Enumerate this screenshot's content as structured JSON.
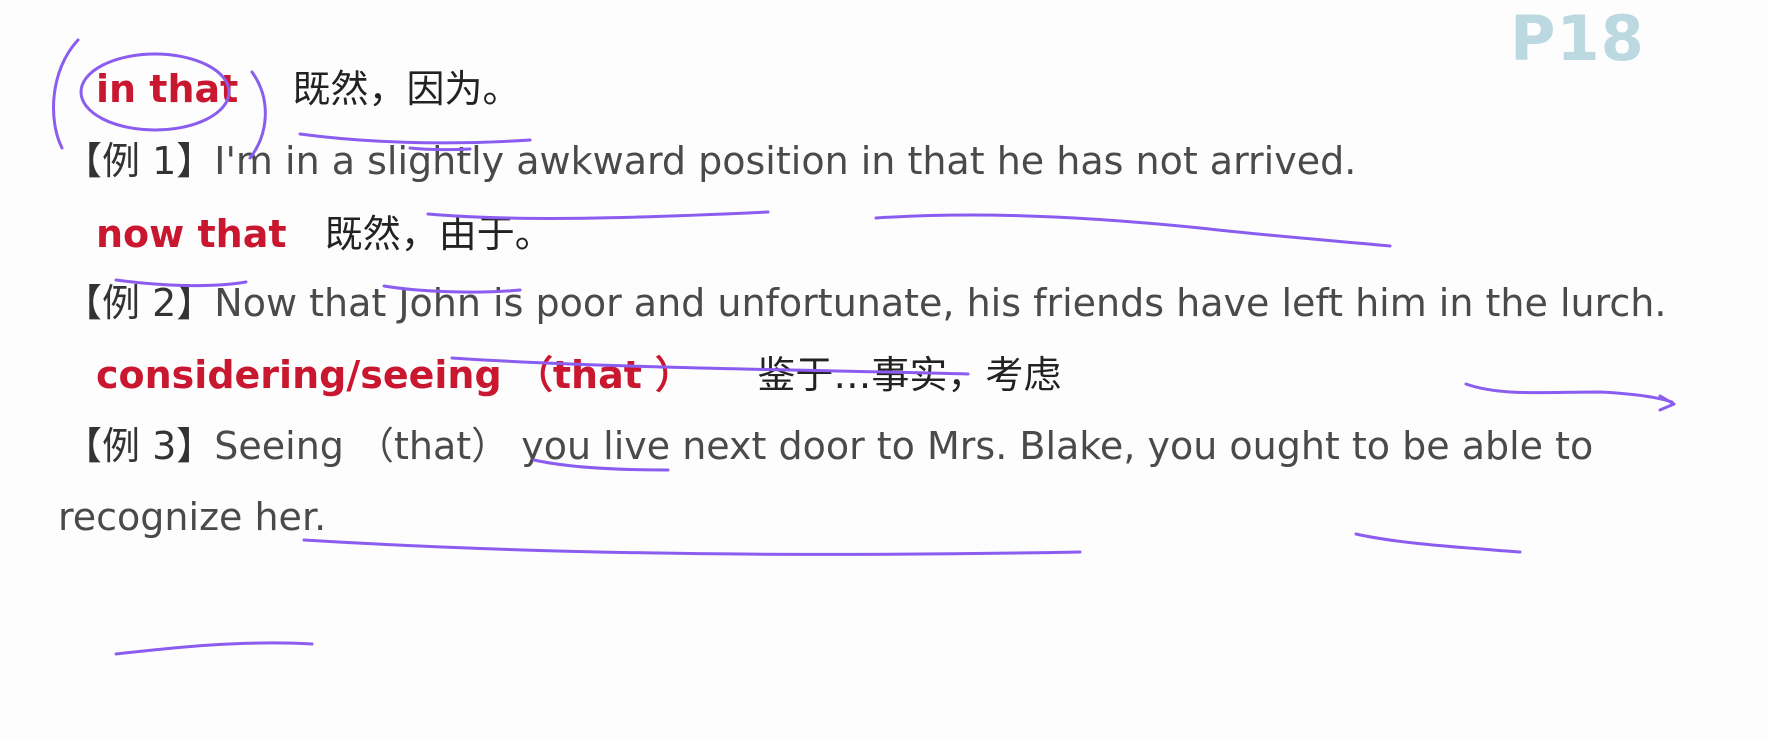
{
  "page_number": "P18",
  "entries": [
    {
      "phrase": "in that",
      "meaning": "既然，因为。",
      "example_tag": "【例 1】",
      "example_text": "I'm in a slightly awkward position in that he has not arrived."
    },
    {
      "phrase": "now that",
      "meaning": "既然，由于。",
      "example_tag": "【例 2】",
      "example_text": "Now that John is poor and unfortunate, his friends have left him in the lurch."
    },
    {
      "phrase": "considering/seeing （that ）",
      "meaning": "鉴于…事实，考虑",
      "example_tag": "【例 3】",
      "example_text": "Seeing （that） you live next door to Mrs. Blake, you ought to be able to",
      "example_text_cont": "recognize her."
    }
  ],
  "colors": {
    "phrase": "#c8172f",
    "annotation": "#8a5cf0",
    "page_number": "#bcd8e0"
  }
}
